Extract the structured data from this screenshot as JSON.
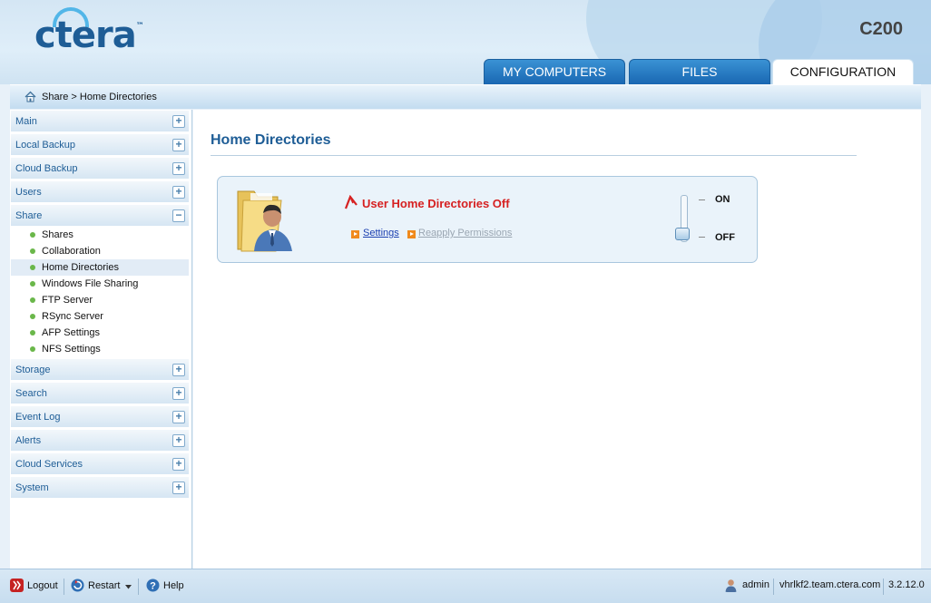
{
  "header": {
    "logo_text": "ctera",
    "logo_tm": "™",
    "model": "C200",
    "tabs": [
      {
        "label": "MY COMPUTERS",
        "active": false
      },
      {
        "label": "FILES",
        "active": false
      },
      {
        "label": "CONFIGURATION",
        "active": true
      }
    ]
  },
  "breadcrumb": {
    "path": "Share > Home Directories",
    "icon": "home-icon"
  },
  "sidebar": {
    "sections": [
      {
        "label": "Main",
        "expanded": false
      },
      {
        "label": "Local Backup",
        "expanded": false
      },
      {
        "label": "Cloud Backup",
        "expanded": false
      },
      {
        "label": "Users",
        "expanded": false
      },
      {
        "label": "Share",
        "expanded": true
      },
      {
        "label": "Storage",
        "expanded": false
      },
      {
        "label": "Search",
        "expanded": false
      },
      {
        "label": "Event Log",
        "expanded": false
      },
      {
        "label": "Alerts",
        "expanded": false
      },
      {
        "label": "Cloud Services",
        "expanded": false
      },
      {
        "label": "System",
        "expanded": false
      }
    ],
    "share_items": [
      {
        "label": "Shares"
      },
      {
        "label": "Collaboration"
      },
      {
        "label": "Home Directories",
        "selected": true
      },
      {
        "label": "Windows File Sharing"
      },
      {
        "label": "FTP Server"
      },
      {
        "label": "RSync Server"
      },
      {
        "label": "AFP Settings"
      },
      {
        "label": "NFS Settings"
      }
    ],
    "expand_symbol": "+",
    "collapse_symbol": "−"
  },
  "main": {
    "title": "Home Directories",
    "panel": {
      "status": "User Home Directories Off",
      "settings_link": "Settings",
      "reapply_link": "Reapply Permissions",
      "toggle_on_label": "ON",
      "toggle_off_label": "OFF",
      "toggle_state": "off"
    }
  },
  "footer": {
    "logout": "Logout",
    "restart": "Restart",
    "help": "Help",
    "user": "admin",
    "host": "vhrlkf2.team.ctera.com",
    "version": "3.2.12.0"
  },
  "colors": {
    "brand_blue": "#1e5d96",
    "status_red": "#d62121",
    "bullet_green": "#6ab74a"
  }
}
